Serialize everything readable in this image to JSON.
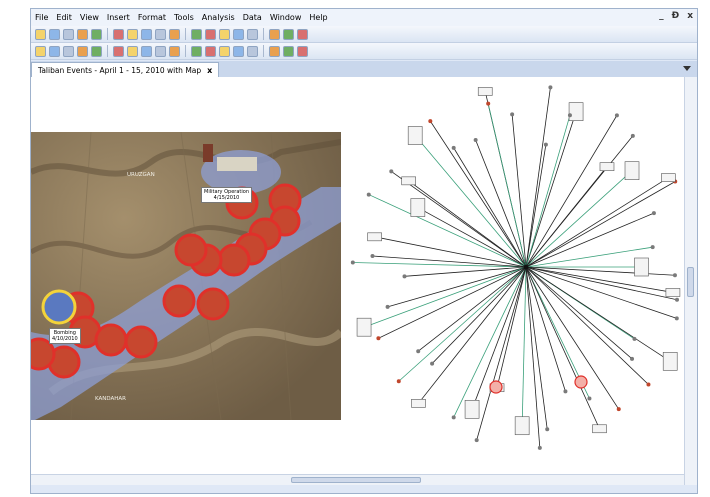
{
  "menu": [
    "File",
    "Edit",
    "View",
    "Insert",
    "Format",
    "Tools",
    "Analysis",
    "Data",
    "Window",
    "Help"
  ],
  "window_controls": [
    "_",
    "Ɖ",
    "x"
  ],
  "toolbar1_icons": [
    "new-icon",
    "open-icon",
    "save-icon",
    "print-icon",
    "cut-icon",
    "undo-icon",
    "redo-icon",
    "select-icon",
    "lasso-icon",
    "zoom-in-icon",
    "zoom-out-icon",
    "zoom-fit-icon",
    "layout-icon",
    "grid-icon",
    "chart-icon",
    "link-icon",
    "cluster-icon",
    "settings-icon"
  ],
  "toolbar2_icons": [
    "pen-icon",
    "circle-icon",
    "shape-icon",
    "node-icon",
    "table-icon",
    "arrow-icon",
    "line-icon",
    "text-icon",
    "align-icon",
    "spacing-icon",
    "flip-icon",
    "rotate-icon",
    "ellipse-icon",
    "color-icon",
    "fill-icon",
    "border-icon",
    "font-icon",
    "help-icon"
  ],
  "tab": {
    "label": "Taliban Events - April 1 - 15, 2010 with Map",
    "close": "x"
  },
  "map": {
    "region_labels": [
      "URUZGAN",
      "KANDAHAR"
    ],
    "callouts": [
      {
        "title": "Military Operation",
        "date": "4/15/2010"
      },
      {
        "title": "Bombing",
        "date": "4/10/2010"
      }
    ]
  },
  "colors": {
    "window_bg": "#dfe8f6",
    "corridor": "#8e9fd6",
    "marker_ring": "#e0302a",
    "highlight_ring": "#f3d33a",
    "network_line": "#222222",
    "network_line_alt": "#3aa07a"
  }
}
